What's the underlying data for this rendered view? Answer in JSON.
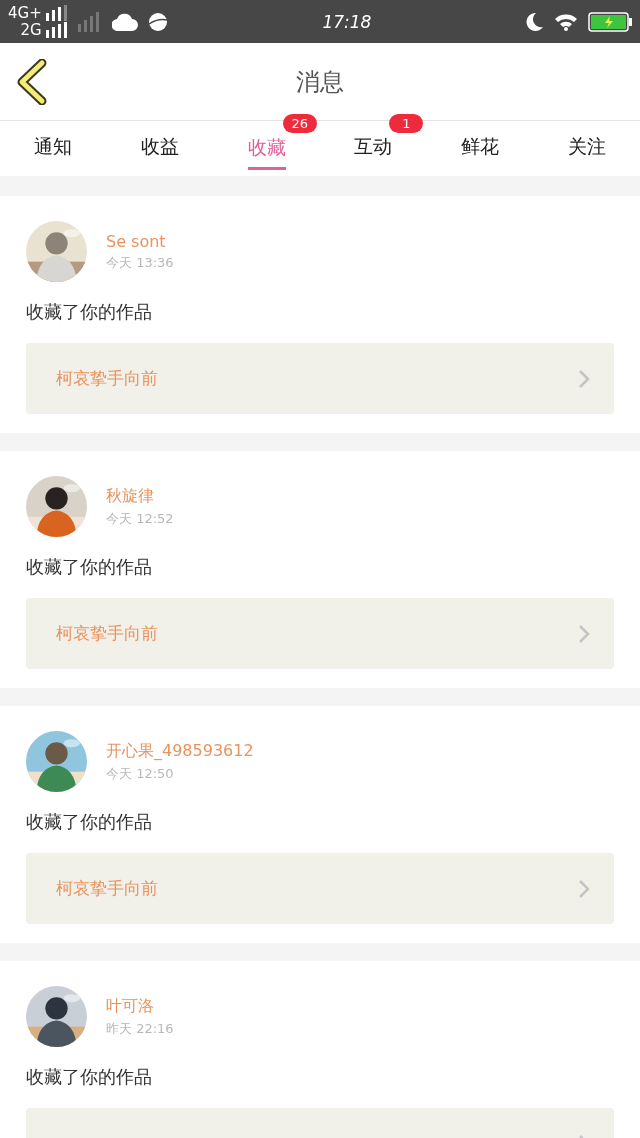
{
  "status_bar": {
    "network_top": "4G+",
    "network_bottom": "2G",
    "time": "17:18"
  },
  "header": {
    "title": "消息"
  },
  "tabs": [
    {
      "label": "通知",
      "selected": false
    },
    {
      "label": "收益",
      "selected": false
    },
    {
      "label": "收藏",
      "selected": true,
      "badge": "26"
    },
    {
      "label": "互动",
      "selected": false,
      "badge": "1"
    },
    {
      "label": "鲜花",
      "selected": false
    },
    {
      "label": "关注",
      "selected": false
    }
  ],
  "messages": [
    {
      "user": "Se sont",
      "time": "今天 13:36",
      "text": "收藏了你的作品",
      "work": "柯哀挚手向前"
    },
    {
      "user": "秋旋律",
      "time": "今天 12:52",
      "text": "收藏了你的作品",
      "work": "柯哀挚手向前"
    },
    {
      "user": "开心果_498593612",
      "time": "今天 12:50",
      "text": "收藏了你的作品",
      "work": "柯哀挚手向前"
    },
    {
      "user": "叶可洛",
      "time": "昨天 22:16",
      "text": "收藏了你的作品"
    }
  ]
}
